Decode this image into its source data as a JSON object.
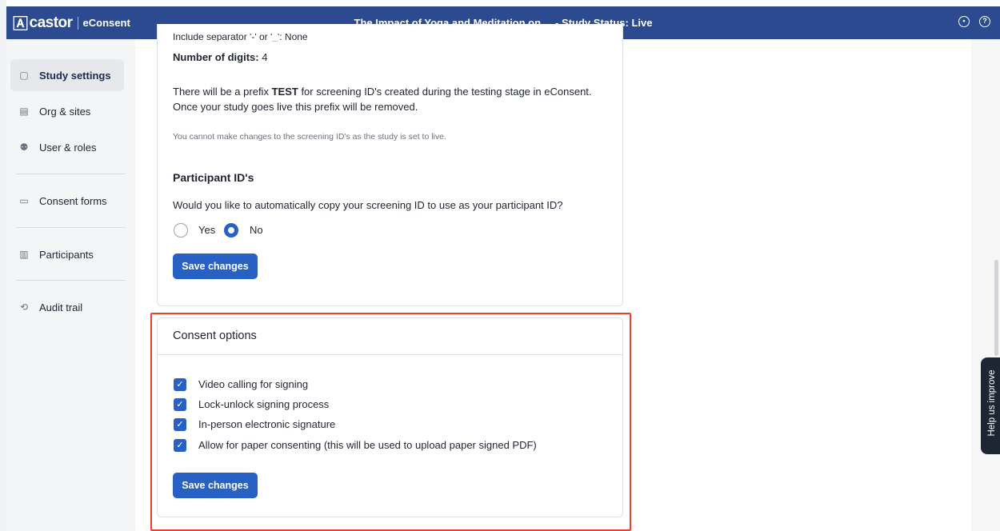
{
  "app": {
    "brand": "castor",
    "product": "eConsent",
    "title": "The Impact of Yoga and Meditation on ...  - Study Status: Live"
  },
  "header_icons": [
    "user-circle-icon",
    "help-circle-icon"
  ],
  "sidebar": {
    "items": [
      {
        "label": "Study settings",
        "icon": "info-square-icon",
        "active": true
      },
      {
        "label": "Org & sites",
        "icon": "building-icon",
        "active": false
      },
      {
        "label": "User & roles",
        "icon": "users-icon",
        "active": false
      },
      {
        "label": "Consent forms",
        "icon": "clipboard-icon",
        "active": false
      },
      {
        "label": "Participants",
        "icon": "id-card-icon",
        "active": false
      },
      {
        "label": "Audit trail",
        "icon": "history-icon",
        "active": false
      }
    ]
  },
  "screening": {
    "cut_line": "Include separator '-' or '_': None",
    "digits_label": "Number of digits:",
    "digits_value": "4",
    "prefix_line1_a": "There will be a prefix",
    "prefix_word": "TEST",
    "prefix_line1_b": "for screening ID's created during the testing stage in eConsent.",
    "prefix_line2": "Once your study goes live this prefix will be removed.",
    "note": "You cannot make changes to the screening ID's as the study is set to live."
  },
  "participant_ids": {
    "heading": "Participant ID's",
    "question": "Would you like to automatically copy your screening ID to use as your participant ID?",
    "options": [
      {
        "label": "Yes",
        "checked": false
      },
      {
        "label": "No",
        "checked": true
      }
    ],
    "save_label": "Save changes"
  },
  "consent_options": {
    "heading": "Consent options",
    "items": [
      {
        "label": "Video calling for signing",
        "checked": true
      },
      {
        "label": "Lock-unlock signing process",
        "checked": true
      },
      {
        "label": "In-person electronic signature",
        "checked": true
      },
      {
        "label": "Allow for paper consenting (this will be used to upload paper signed PDF)",
        "checked": true
      }
    ],
    "save_label": "Save changes"
  },
  "feedback": {
    "label": "Help us improve"
  },
  "colors": {
    "brand": "#2b4a8f",
    "accent": "#2861c4",
    "highlight": "#e8432d"
  }
}
